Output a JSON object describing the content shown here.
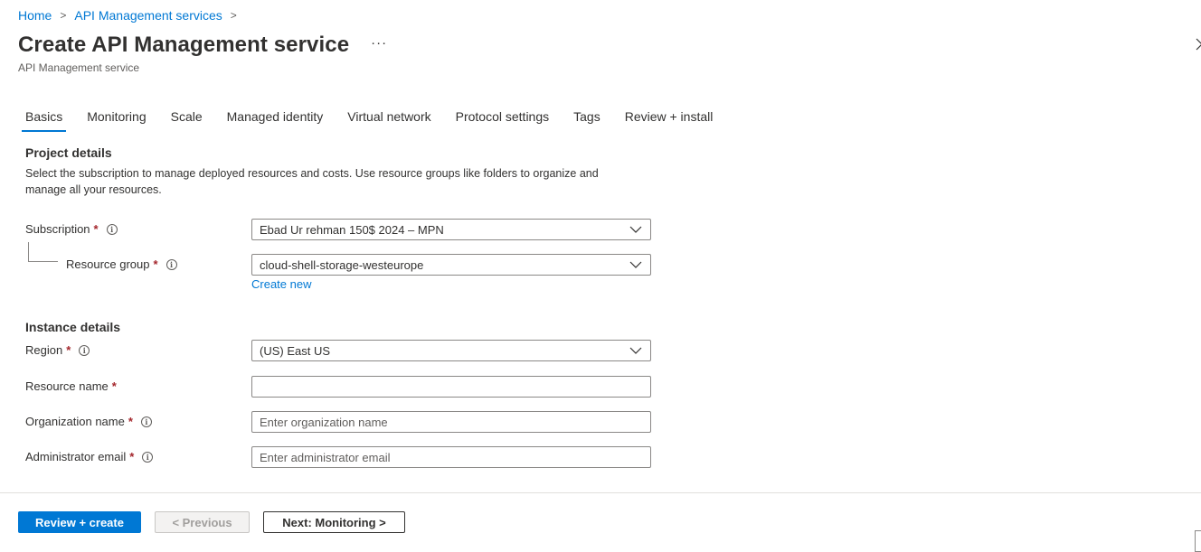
{
  "breadcrumb": {
    "home": "Home",
    "services": "API Management services",
    "separator": ">"
  },
  "header": {
    "title": "Create API Management service",
    "more": "···",
    "subtitle": "API Management service"
  },
  "tabs": [
    {
      "label": "Basics",
      "active": true
    },
    {
      "label": "Monitoring"
    },
    {
      "label": "Scale"
    },
    {
      "label": "Managed identity"
    },
    {
      "label": "Virtual network"
    },
    {
      "label": "Protocol settings"
    },
    {
      "label": "Tags"
    },
    {
      "label": "Review + install"
    }
  ],
  "project": {
    "heading": "Project details",
    "description": "Select the subscription to manage deployed resources and costs. Use resource groups like folders to organize and manage all your resources.",
    "subscription": {
      "label": "Subscription",
      "value": "Ebad Ur rehman 150$ 2024 – MPN"
    },
    "resource_group": {
      "label": "Resource group",
      "value": "cloud-shell-storage-westeurope",
      "create_new": "Create new"
    }
  },
  "instance": {
    "heading": "Instance details",
    "region": {
      "label": "Region",
      "value": "(US) East US"
    },
    "resource_name": {
      "label": "Resource name",
      "value": ""
    },
    "organization_name": {
      "label": "Organization name",
      "placeholder": "Enter organization name"
    },
    "admin_email": {
      "label": "Administrator email",
      "placeholder": "Enter administrator email"
    }
  },
  "common": {
    "required_mark": "*",
    "info_glyph": "i"
  },
  "footer": {
    "review_create": "Review + create",
    "previous": "< Previous",
    "next": "Next: Monitoring >"
  },
  "colors": {
    "accent": "#0078d4",
    "required": "#a4262c",
    "text": "#323130",
    "border": "#8a8886"
  },
  "icons": {
    "info": "info-icon",
    "chevron": "chevron-down-icon",
    "close": "chevron-right-icon"
  }
}
